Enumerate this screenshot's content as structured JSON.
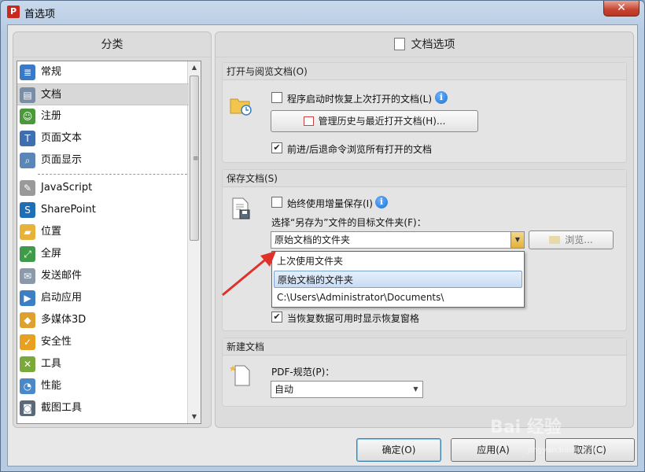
{
  "window": {
    "title": "首选项",
    "close_symbol": "✕"
  },
  "left_panel": {
    "header": "分类",
    "items": [
      {
        "label": "常规",
        "icon": "general-settings-icon",
        "color": "#3a78c8",
        "glyph": "≣"
      },
      {
        "label": "文档",
        "icon": "document-icon",
        "color": "#7a8da6",
        "glyph": "▤"
      },
      {
        "label": "注册",
        "icon": "user-register-icon",
        "color": "#4a9a3a",
        "glyph": "☺"
      },
      {
        "label": "页面文本",
        "icon": "text-icon",
        "color": "#3f6fb0",
        "glyph": "T"
      },
      {
        "label": "页面显示",
        "icon": "page-display-icon",
        "color": "#5b86b8",
        "glyph": "⌕"
      },
      {
        "label": "JavaScript",
        "icon": "script-icon",
        "color": "#9a9a9a",
        "glyph": "✎"
      },
      {
        "label": "SharePoint",
        "icon": "sharepoint-icon",
        "color": "#1e6fb8",
        "glyph": "S"
      },
      {
        "label": "位置",
        "icon": "folder-location-icon",
        "color": "#e6b23a",
        "glyph": "▰"
      },
      {
        "label": "全屏",
        "icon": "fullscreen-icon",
        "color": "#3f9a4a",
        "glyph": "⤢"
      },
      {
        "label": "发送邮件",
        "icon": "email-icon",
        "color": "#8a9aaa",
        "glyph": "✉"
      },
      {
        "label": "启动应用",
        "icon": "launch-app-icon",
        "color": "#3c7fc4",
        "glyph": "▶"
      },
      {
        "label": "多媒体3D",
        "icon": "multimedia-3d-icon",
        "color": "#e0a030",
        "glyph": "◆"
      },
      {
        "label": "安全性",
        "icon": "shield-icon",
        "color": "#e8a020",
        "glyph": "✓"
      },
      {
        "label": "工具",
        "icon": "tools-icon",
        "color": "#7aa83a",
        "glyph": "✕"
      },
      {
        "label": "性能",
        "icon": "performance-gauge-icon",
        "color": "#4a88c8",
        "glyph": "◔"
      },
      {
        "label": "截图工具",
        "icon": "camera-icon",
        "color": "#5a6a7a",
        "glyph": "◙"
      }
    ]
  },
  "right_panel": {
    "header": "文档选项",
    "open_group": {
      "title": "打开与阅览文档(O)",
      "restore_label": "程序启动时恢复上次打开的文档(L)",
      "restore_checked": false,
      "history_button": "管理历史与最近打开文档(H)...",
      "navigate_label": "前进/后退命令浏览所有打开的文档",
      "navigate_checked": true
    },
    "save_group": {
      "title": "保存文档(S)",
      "incremental_label": "始终使用增量保存(I)",
      "incremental_checked": false,
      "target_folder_label": "选择“另存为”文件的目标文件夹(F)：",
      "target_folder_value": "原始文档的文件夹",
      "browse_button": "浏览...",
      "dropdown_options": [
        "上次使用文件夹",
        "原始文档的文件夹",
        "C:\\Users\\Administrator\\Documents\\"
      ],
      "recovery_label": "当恢复数据可用时显示恢复窗格",
      "recovery_checked": true
    },
    "new_group": {
      "title": "新建文档",
      "pdf_standard_label": "PDF-规范(P)：",
      "pdf_standard_value": "自动"
    }
  },
  "footer": {
    "ok": "确定(O)",
    "apply": "应用(A)",
    "cancel": "取消(C)"
  },
  "info_glyph": "i",
  "check_glyph": "✔",
  "dropdown_arrow": "▼",
  "scroll_up": "▲",
  "scroll_down": "▼",
  "scroll_grip": "≡",
  "watermark": {
    "brand": "Bai 经验",
    "sub": "jingyan.baidu.com"
  }
}
